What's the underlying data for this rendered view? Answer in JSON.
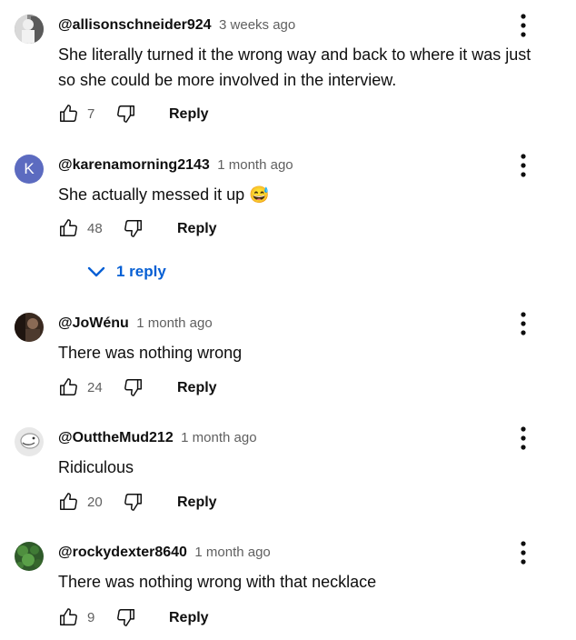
{
  "comments": [
    {
      "author": "@allisonschneider924",
      "time": "3 weeks ago",
      "text": "She literally turned it the wrong way and back to where it was just so she could be more involved in the interview.",
      "likes": "7",
      "reply_label": "Reply"
    },
    {
      "author": "@karenamorning2143",
      "time": "1 month ago",
      "text": "She actually messed it up 😅",
      "likes": "48",
      "reply_label": "Reply",
      "avatar_letter": "K",
      "replies_label": "1 reply"
    },
    {
      "author": "@JoWénu",
      "time": "1 month ago",
      "text": "There was nothing wrong",
      "likes": "24",
      "reply_label": "Reply"
    },
    {
      "author": "@OuttheMud212",
      "time": "1 month ago",
      "text": "Ridiculous",
      "likes": "20",
      "reply_label": "Reply"
    },
    {
      "author": "@rockydexter8640",
      "time": "1 month ago",
      "text": "There was nothing wrong with that necklace",
      "likes": "9",
      "reply_label": "Reply"
    }
  ],
  "colors": {
    "text": "#0f0f0f",
    "secondary": "#606060",
    "link_blue": "#065fd4",
    "avatar_k": "#5c6bc0"
  },
  "icons": [
    "thumbs-up-icon",
    "thumbs-down-icon",
    "more-vert-icon",
    "chevron-down-icon"
  ]
}
